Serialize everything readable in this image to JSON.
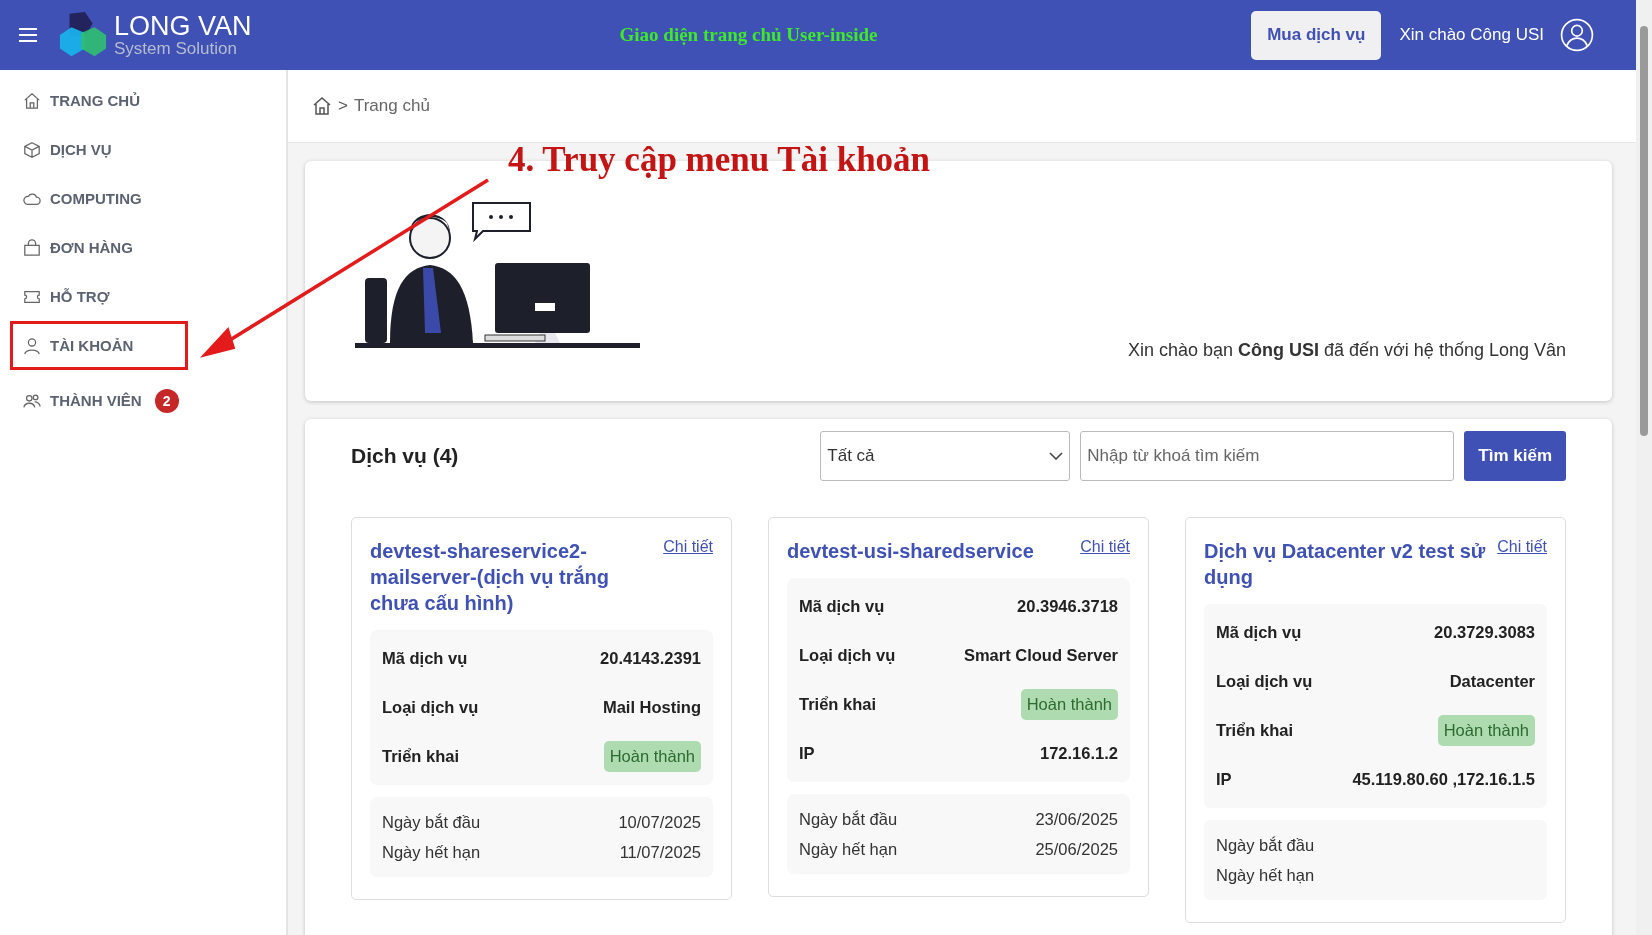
{
  "header": {
    "logo": {
      "name": "LONG VAN",
      "tagline": "System Solution"
    },
    "title": "Giao diện trang chủ User-inside",
    "buy_button": "Mua dịch vụ",
    "greeting": "Xin chào Công USI"
  },
  "sidebar": {
    "items": [
      {
        "label": "TRANG CHỦ",
        "highlighted": false
      },
      {
        "label": "DỊCH VỤ",
        "highlighted": false
      },
      {
        "label": "COMPUTING",
        "highlighted": false
      },
      {
        "label": "ĐƠN HÀNG",
        "highlighted": false
      },
      {
        "label": "HỖ TRỢ",
        "highlighted": false
      },
      {
        "label": "TÀI KHOẢN",
        "highlighted": true
      },
      {
        "label": "THÀNH VIÊN",
        "highlighted": false,
        "badge": "2"
      }
    ]
  },
  "breadcrumb": {
    "separator": ">",
    "items": [
      "Trang chủ"
    ]
  },
  "annotation": {
    "text": "4. Truy cập menu Tài khoản"
  },
  "banner": {
    "message": "Xin chào bạn **Công USI** đã đến với hệ thống Long Vân"
  },
  "services": {
    "title": "Dịch vụ (4)",
    "filter": {
      "value": "Tất cả"
    },
    "search": {
      "placeholder": "Nhập từ khoá tìm kiếm"
    },
    "search_button": "Tìm kiếm",
    "cards": [
      {
        "title": "devtest-shareservice2-mailserver-(dịch vụ trắng chưa cấu hình)",
        "link": "Chi tiết",
        "details": [
          {
            "kind": "text",
            "label": "Mã dịch vụ",
            "value": "20.4143.2391"
          },
          {
            "kind": "text",
            "label": "Loại dịch vụ",
            "value": "Mail Hosting"
          },
          {
            "kind": "status",
            "label": "Triển khai",
            "value": "Hoàn thành"
          }
        ],
        "dates": [
          {
            "label": "Ngày bắt đầu",
            "value": "10/07/2025"
          },
          {
            "label": "Ngày hết hạn",
            "value": "11/07/2025"
          }
        ]
      },
      {
        "title": "devtest-usi-sharedservice",
        "link": "Chi tiết",
        "details": [
          {
            "kind": "text",
            "label": "Mã dịch vụ",
            "value": "20.3946.3718"
          },
          {
            "kind": "text",
            "label": "Loại dịch vụ",
            "value": "Smart Cloud Server"
          },
          {
            "kind": "status",
            "label": "Triển khai",
            "value": "Hoàn thành"
          },
          {
            "kind": "text",
            "label": "IP",
            "value": "172.16.1.2"
          }
        ],
        "dates": [
          {
            "label": "Ngày bắt đầu",
            "value": "23/06/2025"
          },
          {
            "label": "Ngày hết hạn",
            "value": "25/06/2025"
          }
        ]
      },
      {
        "title": "Dịch vụ Datacenter v2 test sử dụng",
        "link": "Chi tiết",
        "details": [
          {
            "kind": "text",
            "label": "Mã dịch vụ",
            "value": "20.3729.3083"
          },
          {
            "kind": "text",
            "label": "Loại dịch vụ",
            "value": "Datacenter"
          },
          {
            "kind": "status",
            "label": "Triển khai",
            "value": "Hoàn thành"
          },
          {
            "kind": "text",
            "label": "IP",
            "value": "45.119.80.60 ,172.16.1.5"
          }
        ],
        "dates": [
          {
            "label": "Ngày bắt đầu"
          },
          {
            "label": "Ngày hết hạn"
          }
        ]
      }
    ]
  }
}
